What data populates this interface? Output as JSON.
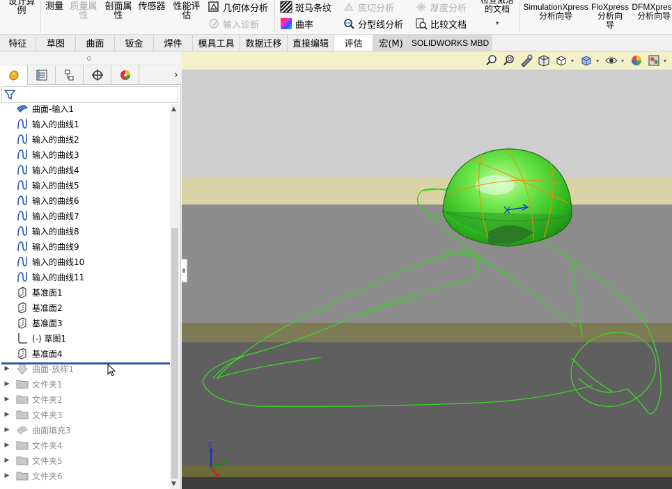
{
  "ribbon": {
    "design_study_label": "设计算\n例",
    "measure_label": "测量",
    "mass_props_label": "质量属\n性",
    "section_props_label": "剖面属\n性",
    "sensor_label": "传感器",
    "performance_label": "性能评\n估",
    "geometry_analysis_label": "几何体分析",
    "import_diagnostics_label": "输入诊断",
    "zebra_label": "斑马条纹",
    "curvature_label": "曲率",
    "undercut_label": "底切分析",
    "parting_line_label": "分型线分析",
    "thickness_label": "厚度分析",
    "compare_label": "比较文档",
    "check_active_label": "检查激活\n的文档",
    "simxpress_label": "SimulationXpress\n分析向导",
    "floxpress_label": "FloXpress\n分析向\n导",
    "dfmxpress_label": "DFMXpress\n分析向导"
  },
  "tabs": [
    {
      "label": "特征"
    },
    {
      "label": "草图"
    },
    {
      "label": "曲面"
    },
    {
      "label": "钣金"
    },
    {
      "label": "焊件"
    },
    {
      "label": "模具工具"
    },
    {
      "label": "数据迁移"
    },
    {
      "label": "直接编辑"
    },
    {
      "label": "评估"
    },
    {
      "label": "宏(M)"
    },
    {
      "label": "SOLIDWORKS MBD"
    }
  ],
  "tree": {
    "items": [
      {
        "label": "曲面-输入1",
        "icon": "import-surface-icon",
        "state": "active"
      },
      {
        "label": "输入的曲线1",
        "icon": "curve-icon",
        "state": "active"
      },
      {
        "label": "输入的曲线2",
        "icon": "curve-icon",
        "state": "active"
      },
      {
        "label": "输入的曲线3",
        "icon": "curve-icon",
        "state": "active"
      },
      {
        "label": "输入的曲线4",
        "icon": "curve-icon",
        "state": "active"
      },
      {
        "label": "输入的曲线5",
        "icon": "curve-icon",
        "state": "active"
      },
      {
        "label": "输入的曲线6",
        "icon": "curve-icon",
        "state": "active"
      },
      {
        "label": "输入的曲线7",
        "icon": "curve-icon",
        "state": "active"
      },
      {
        "label": "输入的曲线8",
        "icon": "curve-icon",
        "state": "active"
      },
      {
        "label": "输入的曲线9",
        "icon": "curve-icon",
        "state": "active"
      },
      {
        "label": "输入的曲线10",
        "icon": "curve-icon",
        "state": "active"
      },
      {
        "label": "输入的曲线11",
        "icon": "curve-icon",
        "state": "active"
      },
      {
        "label": "基准面1",
        "icon": "plane-icon",
        "state": "active"
      },
      {
        "label": "基准面2",
        "icon": "plane-icon",
        "state": "active"
      },
      {
        "label": "基准面3",
        "icon": "plane-icon",
        "state": "active"
      },
      {
        "label": "(-) 草图1",
        "icon": "sketch-icon",
        "state": "active"
      },
      {
        "label": "基准面4",
        "icon": "plane-icon",
        "state": "active"
      },
      {
        "label": "曲面-放样1",
        "icon": "loft-surface-icon",
        "state": "suppressed"
      },
      {
        "label": "文件夹1",
        "icon": "folder-icon",
        "state": "suppressed"
      },
      {
        "label": "文件夹2",
        "icon": "folder-icon",
        "state": "suppressed"
      },
      {
        "label": "文件夹3",
        "icon": "folder-icon",
        "state": "suppressed"
      },
      {
        "label": "曲面填充3",
        "icon": "fill-surface-icon",
        "state": "suppressed"
      },
      {
        "label": "文件夹4",
        "icon": "folder-icon",
        "state": "suppressed"
      },
      {
        "label": "文件夹5",
        "icon": "folder-icon",
        "state": "suppressed"
      },
      {
        "label": "文件夹6",
        "icon": "folder-icon",
        "state": "suppressed"
      }
    ]
  },
  "triad": {
    "z_label": "Z"
  },
  "colors": {
    "accent_blue": "#2c5aa0",
    "shape_green": "#3ccf2a",
    "viewport_top": "#cfcfcf",
    "viewport_mid": "#8a8a8a",
    "viewport_floor": "#5c5c5c"
  }
}
